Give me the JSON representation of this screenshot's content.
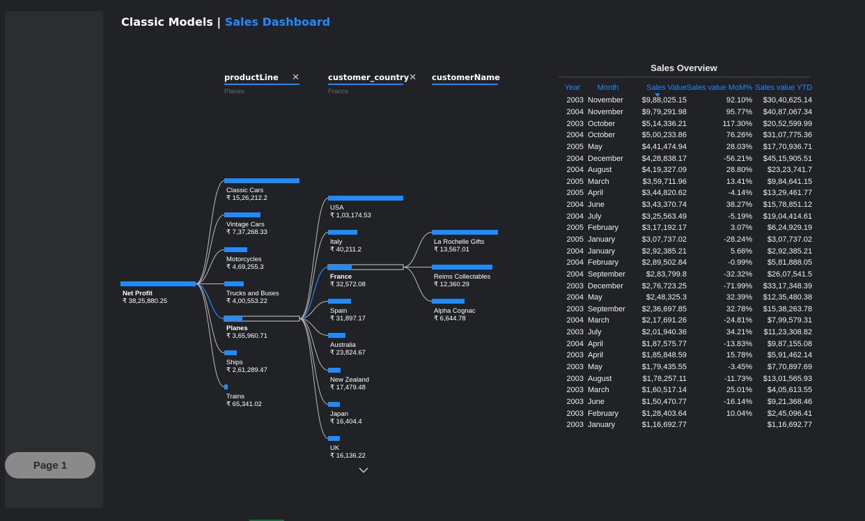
{
  "sidebar": {
    "page_label": "Page 1"
  },
  "header": {
    "title_part1": "Classic Models | ",
    "title_part2": "Sales Dashboard"
  },
  "slicers": [
    {
      "name": "productLine",
      "value": "Planes",
      "has_clear": true
    },
    {
      "name": "customer_country",
      "value": "France",
      "has_clear": true
    },
    {
      "name": "customerName",
      "value": "",
      "has_clear": false
    }
  ],
  "tree": {
    "root": {
      "label": "Net Profit",
      "value": "₹ 38,25,880.25",
      "amount": 3825880.25
    },
    "level1": [
      {
        "label": "Classic Cars",
        "value": "₹ 15,26,212.2",
        "amount": 1526212.2
      },
      {
        "label": "Vintage Cars",
        "value": "₹ 7,37,268.33",
        "amount": 737268.33
      },
      {
        "label": "Motorcycles",
        "value": "₹ 4,69,255.3",
        "amount": 469255.3
      },
      {
        "label": "Trucks and Buses",
        "value": "₹ 4,00,553.22",
        "amount": 400553.22
      },
      {
        "label": "Planes",
        "value": "₹ 3,65,960.71",
        "amount": 365960.71,
        "selected": true
      },
      {
        "label": "Ships",
        "value": "₹ 2,61,289.47",
        "amount": 261289.47
      },
      {
        "label": "Trains",
        "value": "₹ 65,341.02",
        "amount": 65341.02
      }
    ],
    "level2": [
      {
        "label": "USA",
        "value": "₹ 1,03,174.53",
        "amount": 103174.53
      },
      {
        "label": "Italy",
        "value": "₹ 40,211.2",
        "amount": 40211.2
      },
      {
        "label": "France",
        "value": "₹ 32,572.08",
        "amount": 32572.08,
        "selected": true
      },
      {
        "label": "Spain",
        "value": "₹ 31,897.17",
        "amount": 31897.17
      },
      {
        "label": "Australia",
        "value": "₹ 23,824.67",
        "amount": 23824.67
      },
      {
        "label": "New Zealand",
        "value": "₹ 17,479.48",
        "amount": 17479.48
      },
      {
        "label": "Japan",
        "value": "₹ 16,404.4",
        "amount": 16404.4
      },
      {
        "label": "UK",
        "value": "₹ 16,136.22",
        "amount": 16136.22
      }
    ],
    "level3": [
      {
        "label": "La Rochelle Gifts",
        "value": "₹ 13,567.01",
        "amount": 13567.01
      },
      {
        "label": "Reims Collectables",
        "value": "₹ 12,360.29",
        "amount": 12360.29
      },
      {
        "label": "Alpha Cognac",
        "value": "₹ 6,644.78",
        "amount": 6644.78
      }
    ]
  },
  "sales_table": {
    "title": "Sales Overview",
    "columns": [
      "Year",
      "Month",
      "Sales Value",
      "Sales value MoM%",
      "Sales value YTD"
    ],
    "rows": [
      [
        "2003",
        "November",
        "$9,88,025.15",
        "92.10%",
        "$30,40,625.14"
      ],
      [
        "2004",
        "November",
        "$9,79,291.98",
        "95.77%",
        "$40,87,067.34"
      ],
      [
        "2003",
        "October",
        "$5,14,336.21",
        "117.30%",
        "$20,52,599.99"
      ],
      [
        "2004",
        "October",
        "$5,00,233.86",
        "76.26%",
        "$31,07,775.36"
      ],
      [
        "2005",
        "May",
        "$4,41,474.94",
        "28.03%",
        "$17,70,936.71"
      ],
      [
        "2004",
        "December",
        "$4,28,838.17",
        "-56.21%",
        "$45,15,905.51"
      ],
      [
        "2004",
        "August",
        "$4,19,327.09",
        "28.80%",
        "$23,23,741.7"
      ],
      [
        "2005",
        "March",
        "$3,59,711.96",
        "13.41%",
        "$9,84,641.15"
      ],
      [
        "2005",
        "April",
        "$3,44,820.62",
        "-4.14%",
        "$13,29,461.77"
      ],
      [
        "2004",
        "June",
        "$3,43,370.74",
        "38.27%",
        "$15,78,851.12"
      ],
      [
        "2004",
        "July",
        "$3,25,563.49",
        "-5.19%",
        "$19,04,414.61"
      ],
      [
        "2005",
        "February",
        "$3,17,192.17",
        "3.07%",
        "$6,24,929.19"
      ],
      [
        "2005",
        "January",
        "$3,07,737.02",
        "-28.24%",
        "$3,07,737.02"
      ],
      [
        "2004",
        "January",
        "$2,92,385.21",
        "5.66%",
        "$2,92,385.21"
      ],
      [
        "2004",
        "February",
        "$2,89,502.84",
        "-0.99%",
        "$5,81,888.05"
      ],
      [
        "2004",
        "September",
        "$2,83,799.8",
        "-32.32%",
        "$26,07,541.5"
      ],
      [
        "2003",
        "December",
        "$2,76,723.25",
        "-71.99%",
        "$33,17,348.39"
      ],
      [
        "2004",
        "May",
        "$2,48,325.3",
        "32.39%",
        "$12,35,480.38"
      ],
      [
        "2003",
        "September",
        "$2,36,697.85",
        "32.78%",
        "$15,38,263.78"
      ],
      [
        "2004",
        "March",
        "$2,17,691.26",
        "-24.81%",
        "$7,99,579.31"
      ],
      [
        "2003",
        "July",
        "$2,01,940.36",
        "34.21%",
        "$11,23,308.82"
      ],
      [
        "2004",
        "April",
        "$1,87,575.77",
        "-13.83%",
        "$9,87,155.08"
      ],
      [
        "2003",
        "April",
        "$1,85,848.59",
        "15.78%",
        "$5,91,462.14"
      ],
      [
        "2003",
        "May",
        "$1,79,435.55",
        "-3.45%",
        "$7,70,897.69"
      ],
      [
        "2003",
        "August",
        "$1,78,257.11",
        "-11.73%",
        "$13,01,565.93"
      ],
      [
        "2003",
        "March",
        "$1,60,517.14",
        "25.01%",
        "$4,05,613.55"
      ],
      [
        "2003",
        "June",
        "$1,50,470.77",
        "-16.14%",
        "$9,21,368.46"
      ],
      [
        "2003",
        "February",
        "$1,28,403.64",
        "10.04%",
        "$2,45,096.41"
      ],
      [
        "2003",
        "January",
        "$1,16,692.77",
        "",
        "$1,16,692.77"
      ]
    ]
  },
  "colors": {
    "accent": "#1f8bff",
    "background": "#202225",
    "panel": "#2b2d31",
    "text": "#e6e6e6"
  },
  "icons": {
    "clear": "close-icon",
    "expand": "chevron-down-icon"
  }
}
